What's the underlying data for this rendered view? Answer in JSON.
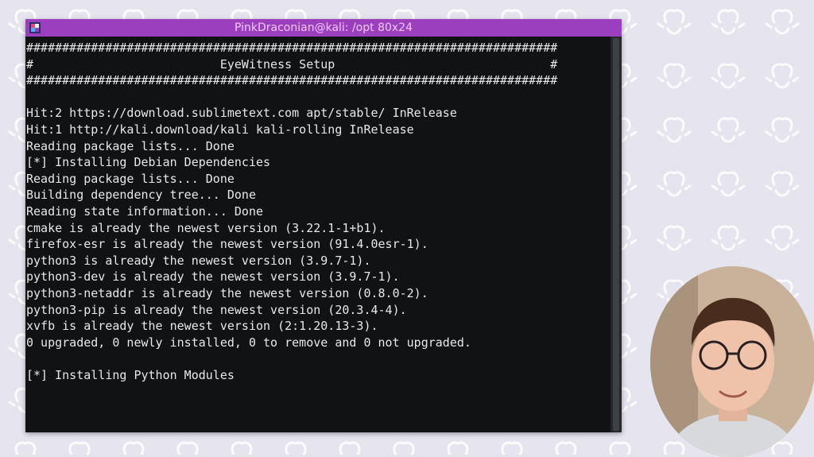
{
  "window": {
    "title": "PinkDraconian@kali: /opt 80x24",
    "icon": "terminal-app-icon"
  },
  "terminal": {
    "lines": [
      "##########################################################################",
      "#                          EyeWitness Setup                              #",
      "##########################################################################",
      "",
      "Hit:2 https://download.sublimetext.com apt/stable/ InRelease",
      "Hit:1 http://kali.download/kali kali-rolling InRelease",
      "Reading package lists... Done",
      "[*] Installing Debian Dependencies",
      "Reading package lists... Done",
      "Building dependency tree... Done",
      "Reading state information... Done",
      "cmake is already the newest version (3.22.1-1+b1).",
      "firefox-esr is already the newest version (91.4.0esr-1).",
      "python3 is already the newest version (3.9.7-1).",
      "python3-dev is already the newest version (3.9.7-1).",
      "python3-netaddr is already the newest version (0.8.0-2).",
      "python3-pip is already the newest version (20.3.4-4).",
      "xvfb is already the newest version (2:1.20.13-3).",
      "0 upgraded, 0 newly installed, 0 to remove and 0 not upgraded.",
      "",
      "[*] Installing Python Modules"
    ]
  },
  "colors": {
    "titlebar": "#9b3fbf",
    "terminal_bg": "#101214",
    "terminal_fg": "#e8e8e8",
    "page_bg": "#e6e4ee"
  }
}
